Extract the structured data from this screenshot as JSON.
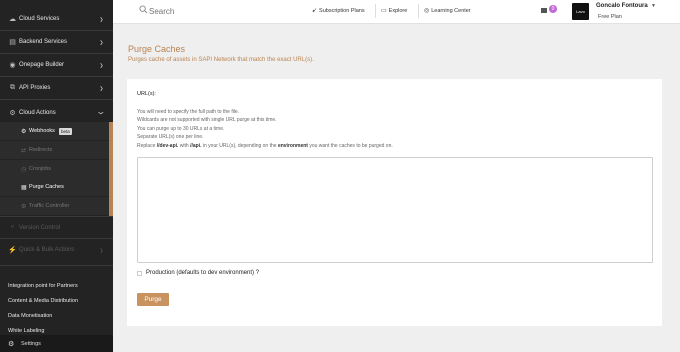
{
  "sidebar": {
    "items": [
      {
        "label": "Cloud Services",
        "icon": "cloud-icon"
      },
      {
        "label": "Backend Services",
        "icon": "server-icon"
      },
      {
        "label": "Onepage Builder",
        "icon": "builder-icon"
      },
      {
        "label": "API Proxies",
        "icon": "proxy-icon"
      },
      {
        "label": "Cloud Actions",
        "icon": "gear-icon"
      }
    ],
    "sub_items": [
      {
        "label": "Webhooks",
        "badge": "beta"
      },
      {
        "label": "Redirects"
      },
      {
        "label": "Cronjobs"
      },
      {
        "label": "Purge Caches"
      },
      {
        "label": "Traffic Controller"
      }
    ],
    "faded": [
      {
        "label": "Version Control"
      },
      {
        "label": "Quick & Bulk Actions"
      }
    ],
    "bottom_links": [
      "Integration point for Partners",
      "Content & Media Distribution",
      "Data Monetisation",
      "White Labeling"
    ],
    "settings_label": "Settings"
  },
  "header": {
    "search_placeholder": "Search",
    "links": [
      {
        "label": "Subscription Plans",
        "icon": "rocket-icon"
      },
      {
        "label": "Explore",
        "icon": "monitor-icon"
      },
      {
        "label": "Learning Center",
        "icon": "help-icon"
      }
    ],
    "notification_count": "0",
    "avatar_text": "Lavo",
    "user_name": "Goncalo Fontoura",
    "user_plan": "Free Plan"
  },
  "main": {
    "title": "Purge Caches",
    "subtitle": "Purges cache of assets in SAPI Network that match the exact URL(s).",
    "field_label": "URL(s):",
    "help": {
      "line1": "You will need to specify the full path to the file.",
      "line2": "Wildcards are not supported with single URL purge at this time.",
      "line3": "You can purge up to 30 URLs at a time.",
      "line4": "Separate URL(s) one per line.",
      "line5_a": "Replace ",
      "line5_b": "//dev-api.",
      "line5_c": " with ",
      "line5_d": "//api.",
      "line5_e": " in your URL(s), depending on the ",
      "line5_f": "environment",
      "line5_g": " you want the caches to be purged on."
    },
    "urls_value": "",
    "checkbox_label": "Production (defaults to dev environment) ?",
    "purge_button": "Purge"
  },
  "colors": {
    "accent": "#b98452",
    "button": "#c8935f",
    "sidebar_bg": "#232323",
    "notification": "#c06ad6"
  }
}
